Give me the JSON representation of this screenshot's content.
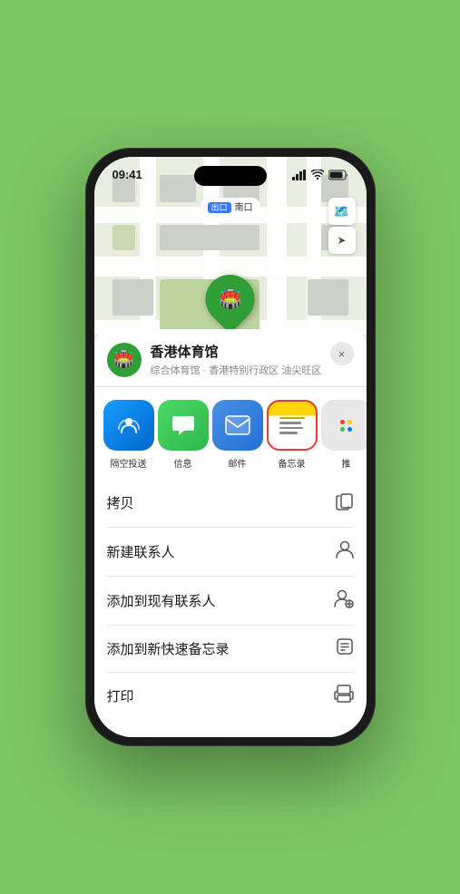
{
  "status_bar": {
    "time": "09:41",
    "location_arrow": true
  },
  "map": {
    "label_tag": "出口",
    "label_text": "南口",
    "venue_name_pin": "香港体育馆",
    "pin_emoji": "🏟️"
  },
  "map_controls": {
    "map_icon": "🗺️",
    "location_icon": "⬆"
  },
  "venue_card": {
    "icon_emoji": "🏟️",
    "name": "香港体育馆",
    "subtitle": "综合体育馆 · 香港特别行政区 油尖旺区",
    "close_label": "×"
  },
  "share_items": [
    {
      "id": "airdrop",
      "label": "隔空投送",
      "type": "airdrop"
    },
    {
      "id": "messages",
      "label": "信息",
      "type": "messages"
    },
    {
      "id": "mail",
      "label": "邮件",
      "type": "mail"
    },
    {
      "id": "notes",
      "label": "备忘录",
      "type": "notes"
    },
    {
      "id": "more",
      "label": "推",
      "type": "more"
    }
  ],
  "action_items": [
    {
      "id": "copy",
      "label": "拷贝",
      "icon": "copy"
    },
    {
      "id": "new-contact",
      "label": "新建联系人",
      "icon": "person"
    },
    {
      "id": "add-existing",
      "label": "添加到现有联系人",
      "icon": "person-add"
    },
    {
      "id": "add-notes",
      "label": "添加到新快速备忘录",
      "icon": "note"
    },
    {
      "id": "print",
      "label": "打印",
      "icon": "print"
    }
  ]
}
